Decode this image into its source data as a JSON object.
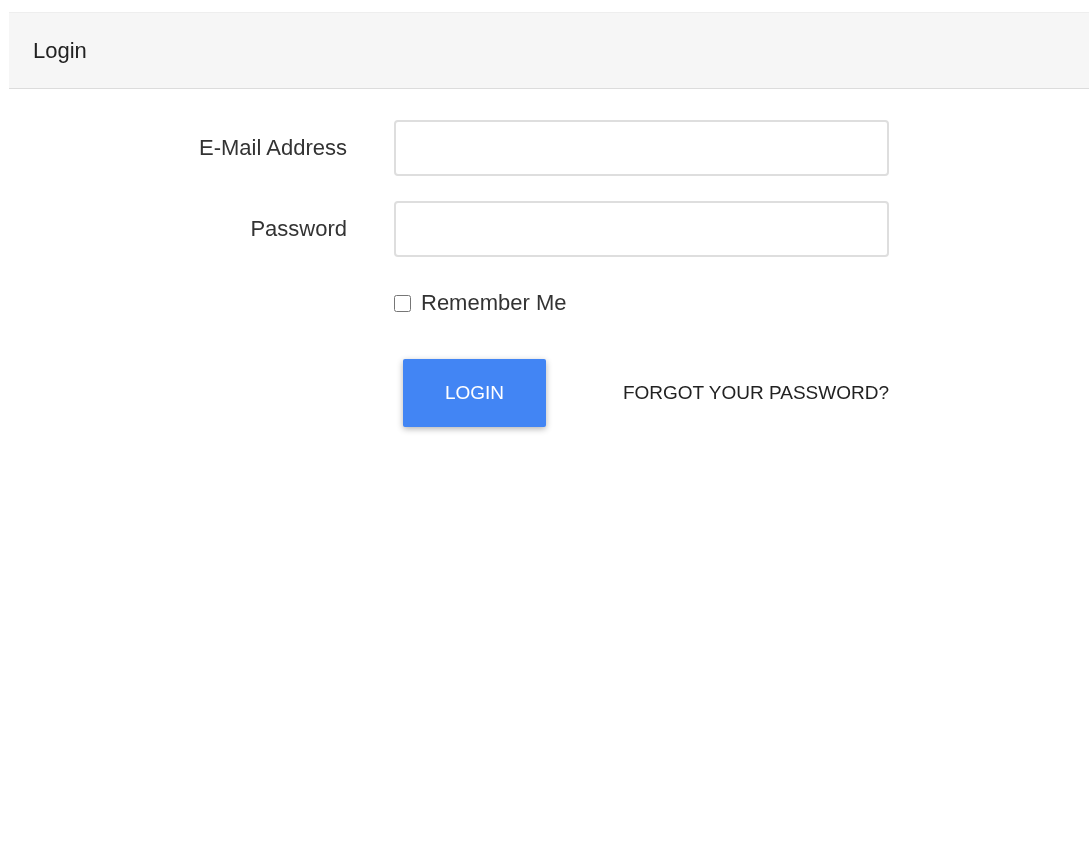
{
  "card": {
    "title": "Login"
  },
  "form": {
    "fields": [
      {
        "label": "E-Mail Address"
      },
      {
        "label": "Password"
      }
    ],
    "remember": {
      "label": "Remember Me",
      "checked": false
    },
    "submit": "LOGIN",
    "forgot_link": "FORGOT YOUR PASSWORD?"
  }
}
